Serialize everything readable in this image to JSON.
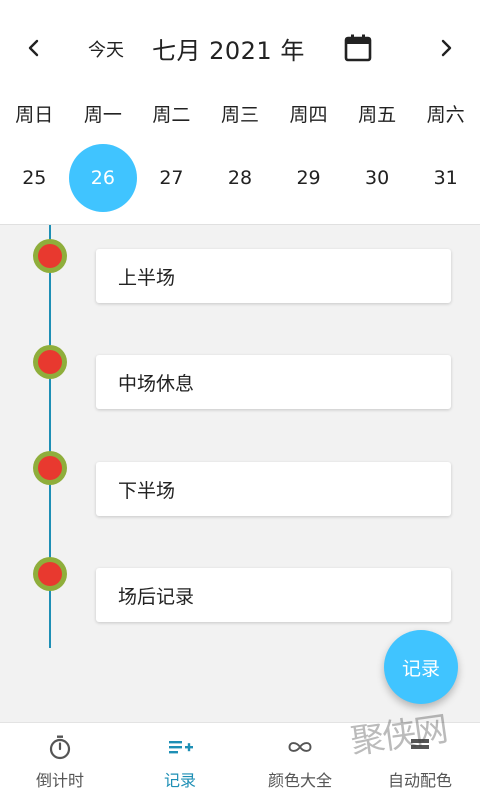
{
  "header": {
    "today_label": "今天",
    "month_title": "七月 2021 年",
    "weekdays": [
      "周日",
      "周一",
      "周二",
      "周三",
      "周四",
      "周五",
      "周六"
    ],
    "dates": [
      "25",
      "26",
      "27",
      "28",
      "29",
      "30",
      "31"
    ],
    "selected_date": "26"
  },
  "timeline": {
    "items": [
      {
        "label": "上半场"
      },
      {
        "label": "中场休息"
      },
      {
        "label": "下半场"
      },
      {
        "label": "场后记录"
      }
    ]
  },
  "fab": {
    "label": "记录"
  },
  "bottom_nav": {
    "items": [
      {
        "label": "倒计时",
        "icon": "stopwatch-icon"
      },
      {
        "label": "记录",
        "icon": "list-add-icon",
        "active": true
      },
      {
        "label": "颜色大全",
        "icon": "infinity-icon"
      },
      {
        "label": "自动配色",
        "icon": "palette-icon"
      }
    ]
  },
  "watermark": {
    "text": "聚侠网"
  },
  "colors": {
    "accent": "#40c4ff",
    "nav_active": "#1e8fb5",
    "timeline_line": "#1e8fb5",
    "dot_outer": "#8fae3b",
    "dot_inner": "#e8392f"
  }
}
